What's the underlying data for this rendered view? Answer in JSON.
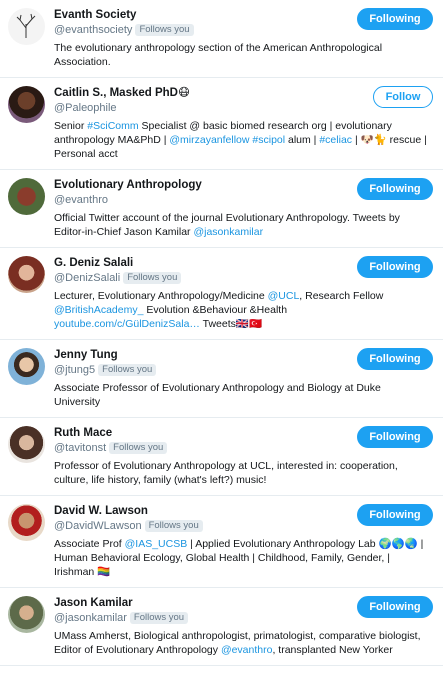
{
  "colors": {
    "accent": "#1da1f2",
    "link": "#1b95e0",
    "muted": "#657786",
    "divider": "#e6ecf0"
  },
  "follows_you_label": "Follows you",
  "users": [
    {
      "name": "Evanth Society",
      "handle": "@evanthsociety",
      "follows_you": true,
      "button": "Following",
      "bio": [
        {
          "t": "The evolutionary anthropology section of the American Anthropological Association."
        }
      ]
    },
    {
      "name": "Caitlin S., Masked PhD😷",
      "handle": "@Paleophile",
      "follows_you": false,
      "button": "Follow",
      "bio": [
        {
          "t": "Senior "
        },
        {
          "t": "#SciComm",
          "link": true
        },
        {
          "t": " Specialist @ basic biomed research org | evolutionary anthropology MA&PhD | "
        },
        {
          "t": "@mirzayanfellow",
          "link": true
        },
        {
          "t": " "
        },
        {
          "t": "#scipol",
          "link": true
        },
        {
          "t": " alum | "
        },
        {
          "t": "#celiac",
          "link": true
        },
        {
          "t": " | 🐶🐈 rescue | Personal acct"
        }
      ]
    },
    {
      "name": "Evolutionary Anthropology",
      "handle": "@evanthro",
      "follows_you": false,
      "button": "Following",
      "bio": [
        {
          "t": "Official Twitter account of the journal Evolutionary Anthropology. Tweets by Editor-in-Chief Jason Kamilar "
        },
        {
          "t": "@jasonkamilar",
          "link": true
        }
      ]
    },
    {
      "name": "G. Deniz Salali",
      "handle": "@DenizSalali",
      "follows_you": true,
      "button": "Following",
      "bio": [
        {
          "t": "Lecturer, Evolutionary Anthropology/Medicine "
        },
        {
          "t": "@UCL",
          "link": true
        },
        {
          "t": ", Research Fellow "
        },
        {
          "t": "@BritishAcademy_",
          "link": true
        },
        {
          "t": " Evolution &Behaviour &Health "
        },
        {
          "t": "youtube.com/c/GülDenizSala…",
          "link": true
        },
        {
          "t": " Tweets🇬🇧🇹🇷"
        }
      ]
    },
    {
      "name": "Jenny Tung",
      "handle": "@jtung5",
      "follows_you": true,
      "button": "Following",
      "bio": [
        {
          "t": "Associate Professor of Evolutionary Anthropology and Biology at Duke University"
        }
      ]
    },
    {
      "name": "Ruth Mace",
      "handle": "@tavitonst",
      "follows_you": true,
      "button": "Following",
      "bio": [
        {
          "t": "Professor of Evolutionary Anthropology at UCL, interested in: cooperation, culture, life history, family (what's left?) music!"
        }
      ]
    },
    {
      "name": "David W. Lawson",
      "handle": "@DavidWLawson",
      "follows_you": true,
      "button": "Following",
      "bio": [
        {
          "t": "Associate Prof "
        },
        {
          "t": "@IAS_UCSB",
          "link": true
        },
        {
          "t": " | Applied Evolutionary Anthropology Lab 🌍🌎🌏 | Human Behavioral Ecology, Global Health | Childhood, Family, Gender, | Irishman 🏳️‍🌈"
        }
      ]
    },
    {
      "name": "Jason Kamilar",
      "handle": "@jasonkamilar",
      "follows_you": true,
      "button": "Following",
      "bio": [
        {
          "t": "UMass Amherst, Biological anthropologist, primatologist, comparative biologist, Editor of Evolutionary Anthropology "
        },
        {
          "t": "@evanthro",
          "link": true
        },
        {
          "t": ", transplanted New Yorker"
        }
      ]
    }
  ]
}
